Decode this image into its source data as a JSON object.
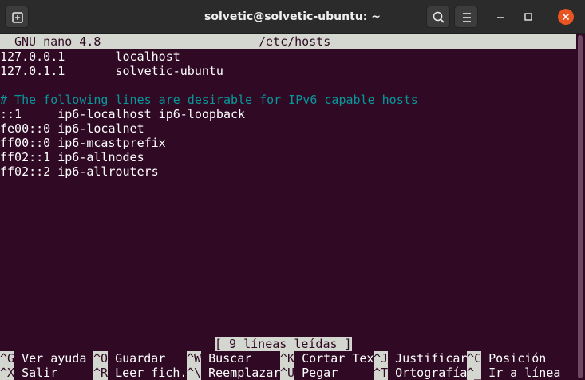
{
  "window": {
    "title": "solvetic@solvetic-ubuntu: ~"
  },
  "nano": {
    "version": "GNU nano 4.8",
    "filename": "/etc/hosts",
    "lines": [
      "127.0.0.1       localhost",
      "127.0.1.1       solvetic-ubuntu",
      "",
      "# The following lines are desirable for IPv6 capable hosts",
      "::1     ip6-localhost ip6-loopback",
      "fe00::0 ip6-localnet",
      "ff00::0 ip6-mcastprefix",
      "ff02::1 ip6-allnodes",
      "ff02::2 ip6-allrouters"
    ],
    "status": "[ 9 líneas leídas ]",
    "shortcuts_row1": [
      {
        "key": "^G",
        "label": " Ver ayuda"
      },
      {
        "key": "^O",
        "label": " Guardar"
      },
      {
        "key": "^W",
        "label": " Buscar"
      },
      {
        "key": "^K",
        "label": " Cortar Tex"
      },
      {
        "key": "^J",
        "label": " Justificar"
      },
      {
        "key": "^C",
        "label": " Posición"
      }
    ],
    "shortcuts_row2": [
      {
        "key": "^X",
        "label": " Salir"
      },
      {
        "key": "^R",
        "label": " Leer fich."
      },
      {
        "key": "^\\",
        "label": " Reemplazar"
      },
      {
        "key": "^U",
        "label": " Pegar"
      },
      {
        "key": "^T",
        "label": " Ortografía"
      },
      {
        "key": "^_",
        "label": " Ir a línea"
      }
    ]
  },
  "icons": {
    "new_tab": "new-tab-icon",
    "search": "search-icon",
    "menu": "hamburger-menu-icon",
    "minimize": "minimize-icon",
    "maximize": "maximize-icon",
    "close": "close-icon"
  },
  "colors": {
    "terminal_bg": "#300a24",
    "comment": "#06989a",
    "highlight_bg": "#d3d7cf",
    "close_accent": "#e95420"
  }
}
